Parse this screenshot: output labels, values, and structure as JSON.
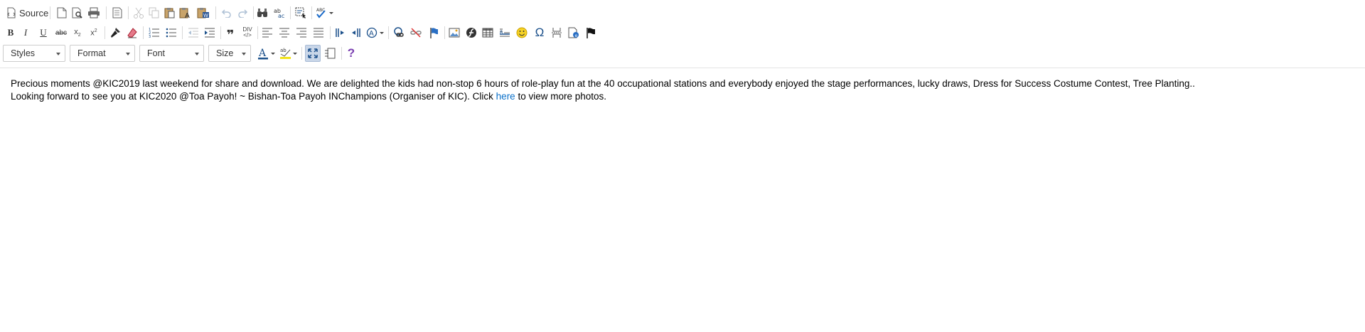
{
  "toolbar": {
    "source_label": "Source",
    "styles_label": "Styles",
    "format_label": "Format",
    "font_label": "Font",
    "size_label": "Size",
    "help_label": "?",
    "accent_color": "#0b70c9",
    "icons_row1": [
      "source-icon",
      "new-page-icon",
      "preview-icon",
      "print-icon",
      "templates-icon",
      "cut-icon",
      "copy-icon",
      "paste-icon",
      "paste-text-icon",
      "paste-word-icon",
      "undo-icon",
      "redo-icon",
      "find-icon",
      "replace-icon",
      "select-all-icon",
      "spellcheck-icon"
    ],
    "icons_row2": [
      "bold-icon",
      "italic-icon",
      "underline-icon",
      "strike-icon",
      "subscript-icon",
      "superscript-icon",
      "copy-format-icon",
      "remove-format-icon",
      "numbered-list-icon",
      "bulleted-list-icon",
      "outdent-icon",
      "indent-icon",
      "blockquote-icon",
      "div-icon",
      "align-left-icon",
      "align-center-icon",
      "align-right-icon",
      "justify-icon",
      "ltr-icon",
      "rtl-icon",
      "language-icon",
      "link-icon",
      "unlink-icon",
      "anchor-icon",
      "image-icon",
      "flash-icon",
      "table-icon",
      "horizontal-rule-icon",
      "smiley-icon",
      "special-char-icon",
      "page-break-icon",
      "iframe-icon",
      "flag-icon"
    ],
    "icons_row3": [
      "text-color-icon",
      "bg-color-icon",
      "maximize-icon",
      "show-blocks-icon",
      "help-icon"
    ]
  },
  "editor": {
    "line1": "Precious moments @KIC2019 last weekend for share and download. We are delighted the kids had non-stop 6 hours of role-play fun at the 40 occupational stations and everybody enjoyed the stage performances, lucky draws, Dress for Success Costume Contest, Tree Planting..",
    "line2_before": "Looking forward to see you at KIC2020 @Toa Payoh! ~ Bishan-Toa Payoh INChampions (Organiser of KIC). Click ",
    "link_text": "here",
    "line2_after": " to view more photos."
  }
}
